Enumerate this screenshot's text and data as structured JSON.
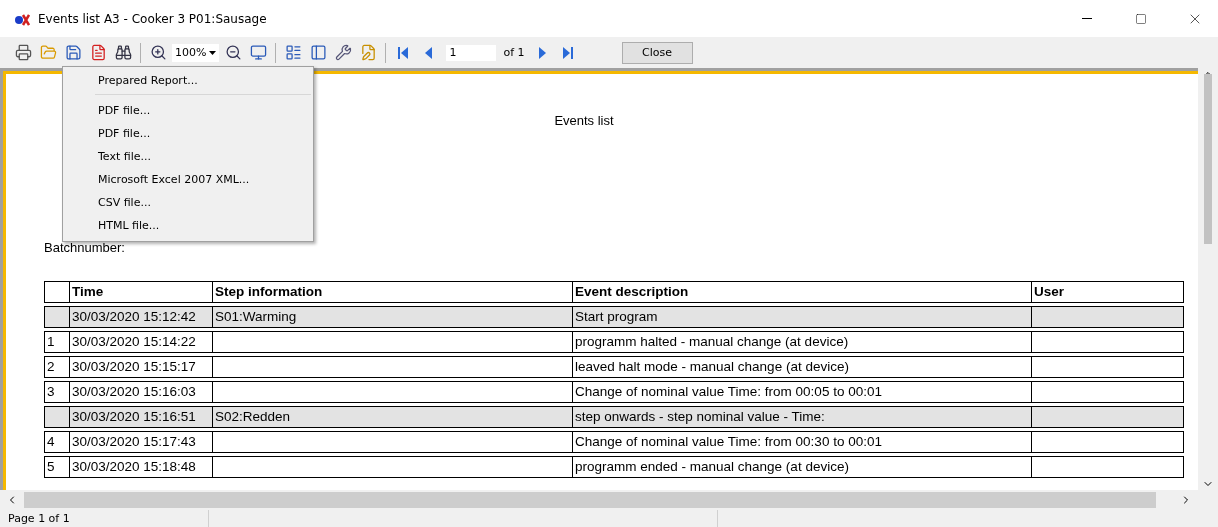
{
  "window": {
    "title": "Events list A3 - Cooker 3 P01:Sausage"
  },
  "toolbar": {
    "zoom": "100%",
    "page": "1",
    "page_count": "of 1",
    "close": "Close"
  },
  "export_menu": {
    "items": [
      {
        "label": "Prepared Report..."
      },
      {
        "label": "PDF file..."
      },
      {
        "label": "PDF file..."
      },
      {
        "label": "Text file..."
      },
      {
        "label": "Microsoft Excel 2007 XML..."
      },
      {
        "label": "CSV file..."
      },
      {
        "label": "HTML file..."
      }
    ]
  },
  "report": {
    "title": "Events list",
    "batch_label": "Batchnumber:",
    "columns": [
      "",
      "Time",
      "Step information",
      "Event description",
      "User"
    ],
    "rows": [
      {
        "kind": "step",
        "time": "30/03/2020 15:12:42",
        "step": "S01:Warming",
        "event": "Start program"
      },
      {
        "kind": "event",
        "index": "1",
        "time": "30/03/2020 15:14:22",
        "event": "programm halted - manual change (at device)"
      },
      {
        "kind": "event",
        "index": "2",
        "time": "30/03/2020 15:15:17",
        "event": "leaved halt mode - manual change (at device)"
      },
      {
        "kind": "event",
        "index": "3",
        "time": "30/03/2020 15:16:03",
        "event": "Change of nominal value Time: from 00:05  to 00:01"
      },
      {
        "kind": "step",
        "time": "30/03/2020 15:16:51",
        "step": "S02:Redden",
        "event": "step onwards - step nominal value - Time:"
      },
      {
        "kind": "event",
        "index": "4",
        "time": "30/03/2020 15:17:43",
        "event": "Change of nominal value Time: from 00:30  to 00:01"
      },
      {
        "kind": "event",
        "index": "5",
        "time": "30/03/2020 15:18:48",
        "event": "programm ended - manual change (at device)"
      }
    ]
  },
  "status_bar": {
    "page": "Page 1 of 1"
  }
}
